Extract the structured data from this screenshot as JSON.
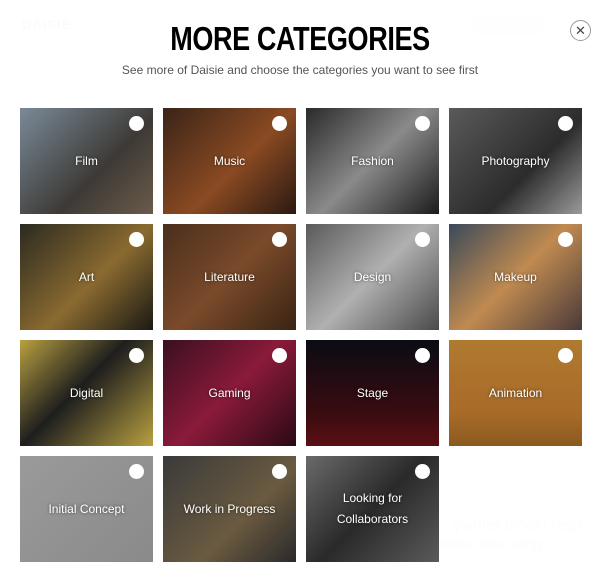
{
  "background": {
    "logo": "DAISIE",
    "snippet": "...ywriter block! help ... write this song"
  },
  "modal": {
    "title": "MORE CATEGORIES",
    "subtitle": "See more of Daisie and choose the categories you want to see first",
    "close_icon": "close-icon",
    "categories": [
      {
        "label": "Film",
        "selected": false,
        "bg": "linear-gradient(135deg,#7a8a98,#3d3a36 60%,#6b5b4a)"
      },
      {
        "label": "Music",
        "selected": false,
        "bg": "linear-gradient(135deg,#3a2418,#8a4a22 55%,#2a1a12)"
      },
      {
        "label": "Fashion",
        "selected": false,
        "bg": "linear-gradient(135deg,#2a2a2a,#8a8a8a 50%,#1c1c1c)"
      },
      {
        "label": "Photography",
        "selected": false,
        "bg": "linear-gradient(135deg,#5a5a5a,#2c2c2c 60%,#9a9a9a)"
      },
      {
        "label": "Art",
        "selected": false,
        "bg": "linear-gradient(135deg,#2a2a20,#8a6a30 55%,#1a1a14)"
      },
      {
        "label": "Literature",
        "selected": false,
        "bg": "linear-gradient(135deg,#4a2e1c,#7a4a2a 50%,#3a2414)"
      },
      {
        "label": "Design",
        "selected": false,
        "bg": "linear-gradient(135deg,#5a5a5a,#b0b0b0 50%,#4a4a4a)"
      },
      {
        "label": "Makeup",
        "selected": false,
        "bg": "linear-gradient(135deg,#3a4a5a,#c08a50 50%,#4a3a3a)"
      },
      {
        "label": "Digital",
        "selected": false,
        "bg": "linear-gradient(135deg,#b8a040,#1e1e1e 45%,#b8a040)"
      },
      {
        "label": "Gaming",
        "selected": false,
        "bg": "linear-gradient(135deg,#3a1020,#8a1a3a 50%,#2a0a14)"
      },
      {
        "label": "Stage",
        "selected": false,
        "bg": "linear-gradient(180deg,#0a0c14,#3a0c10 70%,#5a1014)"
      },
      {
        "label": "Animation",
        "selected": false,
        "bg": "linear-gradient(180deg,#b07a30,#a86a28 70%,#8a5a20)"
      },
      {
        "label": "Initial Concept",
        "selected": false,
        "bg": "linear-gradient(135deg,#9a9a9a,#8a8a8a)"
      },
      {
        "label": "Work in Progress",
        "selected": false,
        "bg": "linear-gradient(135deg,#3a3a3a,#6a5a40 60%,#2a2a2a)"
      },
      {
        "label": "Looking for Collaborators",
        "selected": false,
        "bg": "linear-gradient(135deg,#6a6a6a,#2a2a2a 50%,#5a5a5a)"
      }
    ]
  }
}
